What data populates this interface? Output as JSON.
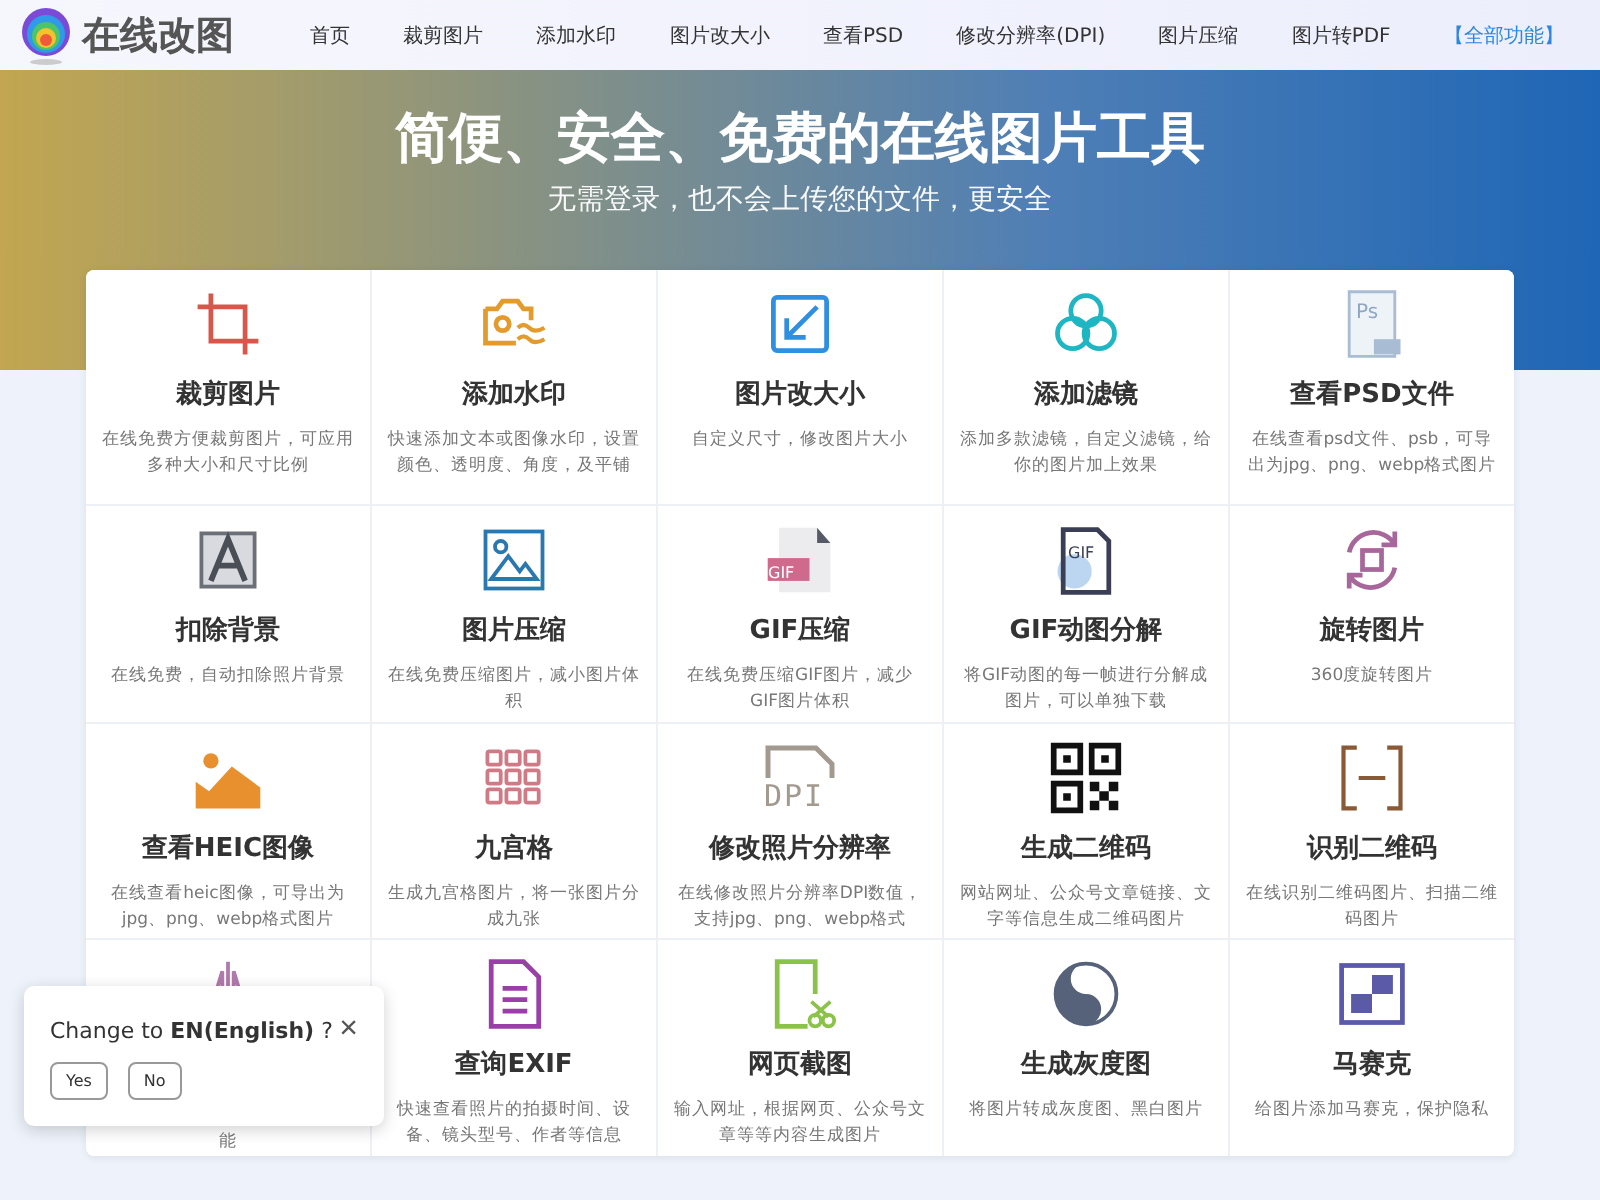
{
  "header": {
    "logo_text": "在线改图",
    "nav": [
      {
        "label": "首页",
        "kind": "page"
      },
      {
        "label": "裁剪图片",
        "kind": "page"
      },
      {
        "label": "添加水印",
        "kind": "page"
      },
      {
        "label": "图片改大小",
        "kind": "page"
      },
      {
        "label": "查看PSD",
        "kind": "page"
      },
      {
        "label": "修改分辨率(DPI)",
        "kind": "page"
      },
      {
        "label": "图片压缩",
        "kind": "page"
      },
      {
        "label": "图片转PDF",
        "kind": "page"
      },
      {
        "label": "【全部功能】",
        "kind": "all"
      }
    ]
  },
  "hero": {
    "title": "简便、安全、免费的在线图片工具",
    "subtitle": "无需登录，也不会上传您的文件，更安全"
  },
  "tools": [
    {
      "title": "裁剪图片",
      "description": "在线免费方便裁剪图片，可应用多种大小和尺寸比例"
    },
    {
      "title": "添加水印",
      "description": "快速添加文本或图像水印，设置颜色、透明度、角度，及平铺"
    },
    {
      "title": "图片改大小",
      "description": "自定义尺寸，修改图片大小"
    },
    {
      "title": "添加滤镜",
      "description": "添加多款滤镜，自定义滤镜，给你的图片加上效果"
    },
    {
      "title": "查看PSD文件",
      "icon_label": "Ps",
      "description": "在线查看psd文件、psb，可导出为jpg、png、webp格式图片"
    },
    {
      "title": "扣除背景",
      "description": "在线免费，自动扣除照片背景"
    },
    {
      "title": "图片压缩",
      "description": "在线免费压缩图片，减小图片体积"
    },
    {
      "title": "GIF压缩",
      "icon_label": "GIF",
      "description": "在线免费压缩GIF图片，减少GIF图片体积"
    },
    {
      "title": "GIF动图分解",
      "icon_label": "GIF",
      "description": "将GIF动图的每一帧进行分解成图片，可以单独下载"
    },
    {
      "title": "旋转图片",
      "description": "360度旋转图片"
    },
    {
      "title": "查看HEIC图像",
      "description": "在线查看heic图像，可导出为jpg、png、webp格式图片"
    },
    {
      "title": "九宫格",
      "description": "生成九宫格图片，将一张图片分成九张"
    },
    {
      "title": "修改照片分辨率",
      "icon_label": "DPI",
      "description": "在线修改照片分辨率DPI数值，支持jpg、png、webp格式"
    },
    {
      "title": "生成二维码",
      "description": "网站网址、公众号文章链接、文字等信息生成二维码图片"
    },
    {
      "title": "识别二维码",
      "description": "在线识别二维码图片、扫描二维码图片"
    },
    {
      "description": "能"
    },
    {
      "title": "查询EXIF",
      "description": "快速查看照片的拍摄时间、设备、镜头型号、作者等信息"
    },
    {
      "title": "网页截图",
      "description": "输入网址，根据网页、公众号文章等等内容生成图片"
    },
    {
      "title": "生成灰度图",
      "description": "将图片转成灰度图、黑白图片"
    },
    {
      "title": "马赛克",
      "description": "给图片添加马赛克，保护隐私"
    }
  ],
  "language_popup": {
    "message": "Change to **EN(English)** ?",
    "close": "×",
    "buttons": [
      "Yes",
      "No"
    ]
  }
}
